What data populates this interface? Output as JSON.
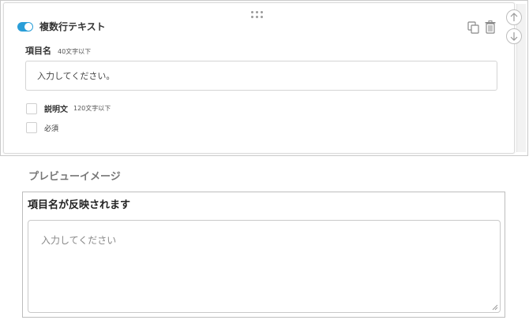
{
  "editor": {
    "toggle_label": "複数行テキスト",
    "toggle_on": true,
    "field_label": "項目名",
    "field_hint": "40文字以下",
    "title_input_value": "入力してください。",
    "description_label": "説明文",
    "description_hint": "120文字以下",
    "required_label": "必須",
    "icons": {
      "drag": "drag-handle-icon",
      "copy": "copy-icon",
      "delete": "trash-icon",
      "up": "arrow-up-icon",
      "down": "arrow-down-icon"
    }
  },
  "preview": {
    "heading": "プレビューイメージ",
    "title": "項目名が反映されます",
    "placeholder": "入力してください"
  },
  "colors": {
    "toggle_accent": "#2a9ed8"
  }
}
